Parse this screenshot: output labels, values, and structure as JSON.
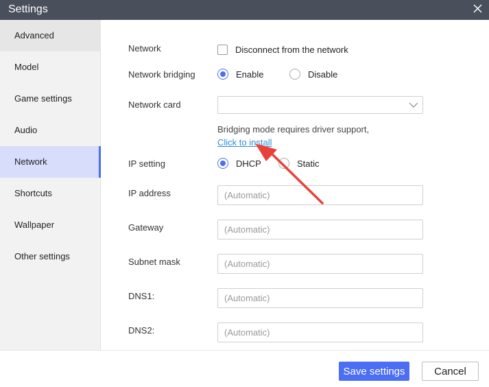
{
  "window": {
    "title": "Settings"
  },
  "sidebar": {
    "items": [
      {
        "label": "Advanced"
      },
      {
        "label": "Model"
      },
      {
        "label": "Game settings"
      },
      {
        "label": "Audio"
      },
      {
        "label": "Network"
      },
      {
        "label": "Shortcuts"
      },
      {
        "label": "Wallpaper"
      },
      {
        "label": "Other settings"
      }
    ],
    "active": "Network"
  },
  "network": {
    "network_label": "Network",
    "disconnect_label": "Disconnect from the network",
    "disconnect_checked": false,
    "bridging_label": "Network bridging",
    "bridging_enable": "Enable",
    "bridging_disable": "Disable",
    "bridging_value": "Enable",
    "card_label": "Network card",
    "card_value": "",
    "bridging_hint": "Bridging mode requires driver support,",
    "install_link": "Click to install",
    "ip_setting_label": "IP setting",
    "ip_dhcp": "DHCP",
    "ip_static": "Static",
    "ip_value": "DHCP",
    "ip_address_label": "IP address",
    "gateway_label": "Gateway",
    "subnet_label": "Subnet mask",
    "dns1_label": "DNS1:",
    "dns2_label": "DNS2:",
    "placeholder": "(Automatic)"
  },
  "footer": {
    "save_label": "Save settings",
    "cancel_label": "Cancel"
  },
  "colors": {
    "accent": "#4b6ef5",
    "titlebar": "#4a4f5c",
    "link": "#2b8fd8",
    "annotation_arrow": "#e8413a"
  }
}
